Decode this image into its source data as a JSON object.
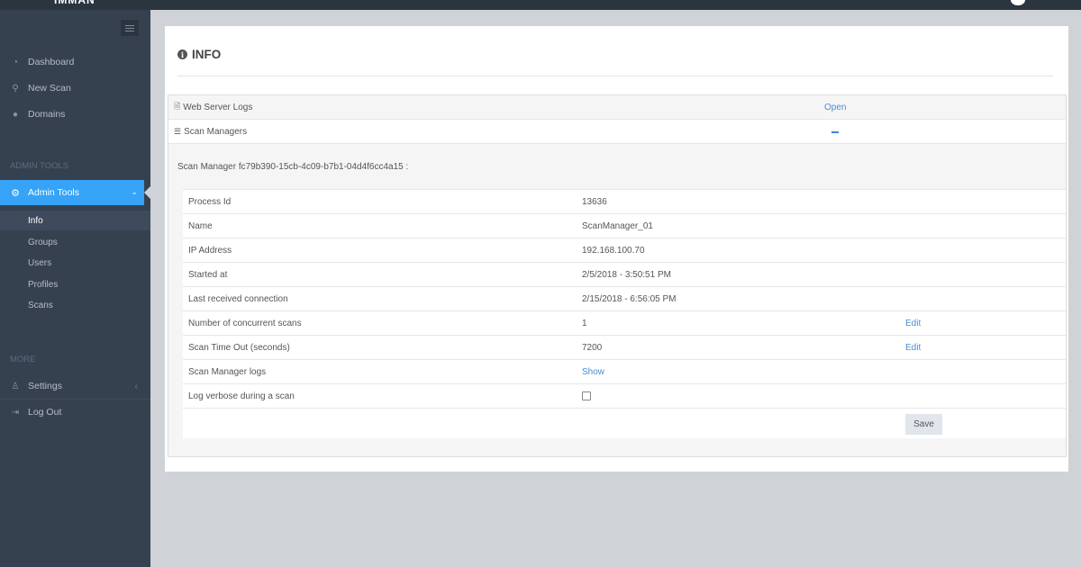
{
  "sidebar": {
    "nav": [
      {
        "label": "Dashboard",
        "icon": "dashboard-icon"
      },
      {
        "label": "New Scan",
        "icon": "search-icon"
      },
      {
        "label": "Domains",
        "icon": "globe-icon"
      }
    ],
    "admin_section": "ADMIN TOOLS",
    "admin_tools": {
      "label": "Admin Tools",
      "icon": "gear-icon"
    },
    "sub_items": [
      "Info",
      "Groups",
      "Users",
      "Profiles",
      "Scans"
    ],
    "more_section": "MORE",
    "settings": {
      "label": "Settings",
      "icon": "user-icon"
    },
    "logout": {
      "label": "Log Out",
      "icon": "logout-icon"
    }
  },
  "main": {
    "title": "INFO",
    "web_server_logs": {
      "label": "Web Server Logs",
      "action": "Open"
    },
    "scan_managers": {
      "label": "Scan Managers"
    },
    "scan_manager_heading": "Scan Manager fc79b390-15cb-4c09-b7b1-04d4f6cc4a15 :",
    "rows": [
      {
        "label": "Process Id",
        "value": "13636",
        "action": ""
      },
      {
        "label": "Name",
        "value": "ScanManager_01",
        "action": ""
      },
      {
        "label": "IP Address",
        "value": "192.168.100.70",
        "action": ""
      },
      {
        "label": "Started at",
        "value": "2/5/2018 - 3:50:51 PM",
        "action": ""
      },
      {
        "label": "Last received connection",
        "value": "2/15/2018 - 6:56:05 PM",
        "action": ""
      },
      {
        "label": "Number of concurrent scans",
        "value": "1",
        "action": "Edit"
      },
      {
        "label": "Scan Time Out (seconds)",
        "value": "7200",
        "action": "Edit"
      },
      {
        "label": "Scan Manager logs",
        "value": "Show",
        "action": ""
      },
      {
        "label": "Log verbose during a scan",
        "value": "",
        "action": ""
      }
    ],
    "save_label": "Save"
  },
  "colors": {
    "sidebar": "#364150",
    "accent": "#36a3f7",
    "link": "#4a8dcf"
  }
}
